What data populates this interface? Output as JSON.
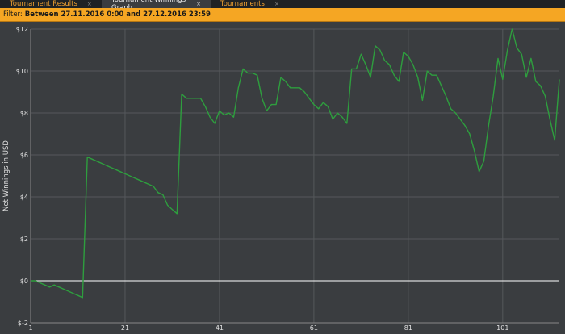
{
  "tabs": [
    {
      "label": "Tournament Results",
      "close": "×",
      "active": false
    },
    {
      "label": "Tournament Winnings Graph",
      "close": "×",
      "active": true
    },
    {
      "label": "Tournaments",
      "close": "×",
      "active": false
    }
  ],
  "filter": {
    "label": "Filter:",
    "value": "Between 27.11.2016 0:00 and 27.12.2016 23:59"
  },
  "colors": {
    "background": "#3a3d40",
    "grid": "#55585b",
    "line": "#2e9e3e",
    "zero_line": "#ffffff",
    "accent": "#f5a623"
  },
  "chart_data": {
    "type": "line",
    "ylabel": "Net Winnings in USD",
    "xlabel": "",
    "xlim": [
      1,
      113
    ],
    "ylim": [
      -2,
      12
    ],
    "x_ticks": [
      1,
      21,
      41,
      61,
      81,
      101
    ],
    "y_ticks": [
      -2,
      0,
      2,
      4,
      6,
      8,
      10,
      12
    ],
    "y_tick_labels": [
      "$-2",
      "$0",
      "$2",
      "$4",
      "$6",
      "$8",
      "$10",
      "$12"
    ],
    "grid": true,
    "series": [
      {
        "x": [
          1,
          2,
          3,
          4,
          5,
          6,
          7,
          8,
          9,
          10,
          11,
          12,
          13,
          14,
          15,
          16,
          17,
          18,
          19,
          20,
          21,
          22,
          23,
          24,
          25,
          26,
          27,
          28,
          29,
          30,
          31,
          32,
          33,
          34,
          35,
          36,
          37,
          38,
          39,
          40,
          41,
          42,
          43,
          44,
          45,
          46,
          47,
          48,
          49,
          50,
          51,
          52,
          53,
          54,
          55,
          56,
          57,
          58,
          59,
          60,
          61,
          62,
          63,
          64,
          65,
          66,
          67,
          68,
          69,
          70,
          71,
          72,
          73,
          74,
          75,
          76,
          77,
          78,
          79,
          80,
          81,
          82,
          83,
          84,
          85,
          86,
          87,
          88,
          89,
          90,
          91,
          92,
          93,
          94,
          95,
          96,
          97,
          98,
          99,
          100,
          101,
          102,
          103,
          104,
          105,
          106,
          107,
          108,
          109,
          110,
          111,
          112,
          113
        ],
        "values": [
          0,
          0,
          -0.1,
          -0.2,
          -0.3,
          -0.2,
          -0.3,
          -0.4,
          -0.5,
          -0.6,
          -0.7,
          -0.8,
          5.9,
          5.8,
          5.7,
          5.6,
          5.5,
          5.4,
          5.3,
          5.2,
          5.1,
          5.0,
          4.9,
          4.8,
          4.7,
          4.6,
          4.5,
          4.2,
          4.1,
          3.6,
          3.4,
          3.2,
          8.9,
          8.7,
          8.7,
          8.7,
          8.7,
          8.3,
          7.8,
          7.5,
          8.1,
          7.9,
          8.0,
          7.8,
          9.2,
          10.1,
          9.9,
          9.9,
          9.8,
          8.7,
          8.1,
          8.4,
          8.4,
          9.7,
          9.5,
          9.2,
          9.2,
          9.2,
          9.0,
          8.7,
          8.4,
          8.2,
          8.5,
          8.3,
          7.7,
          8.0,
          7.8,
          7.5,
          10.1,
          10.1,
          10.8,
          10.3,
          9.7,
          11.2,
          11.0,
          10.5,
          10.3,
          9.8,
          9.5,
          10.9,
          10.7,
          10.3,
          9.7,
          8.6,
          10.0,
          9.8,
          9.8,
          9.3,
          8.8,
          8.2,
          8.0,
          7.7,
          7.4,
          7.0,
          6.2,
          5.2,
          5.7,
          7.4,
          8.8,
          10.6,
          9.6,
          11.0,
          12.0,
          11.1,
          10.8,
          9.7,
          10.6,
          9.5,
          9.3,
          8.8,
          7.7,
          6.7,
          9.6
        ]
      }
    ]
  }
}
